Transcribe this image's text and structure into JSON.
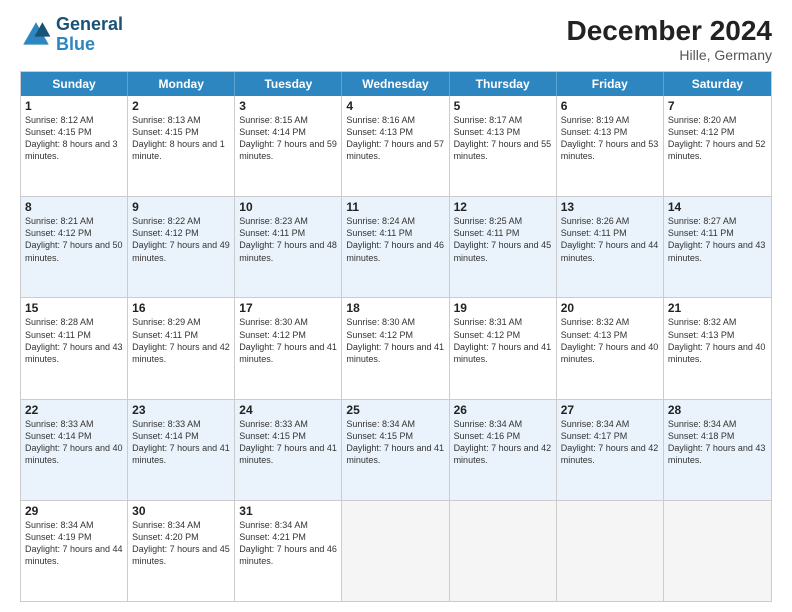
{
  "logo": {
    "general": "General",
    "blue": "Blue"
  },
  "title": "December 2024",
  "subtitle": "Hille, Germany",
  "days": [
    "Sunday",
    "Monday",
    "Tuesday",
    "Wednesday",
    "Thursday",
    "Friday",
    "Saturday"
  ],
  "weeks": [
    [
      {
        "day": "1",
        "sunrise": "8:12 AM",
        "sunset": "4:15 PM",
        "daylight": "8 hours and 3 minutes."
      },
      {
        "day": "2",
        "sunrise": "8:13 AM",
        "sunset": "4:15 PM",
        "daylight": "8 hours and 1 minute."
      },
      {
        "day": "3",
        "sunrise": "8:15 AM",
        "sunset": "4:14 PM",
        "daylight": "7 hours and 59 minutes."
      },
      {
        "day": "4",
        "sunrise": "8:16 AM",
        "sunset": "4:13 PM",
        "daylight": "7 hours and 57 minutes."
      },
      {
        "day": "5",
        "sunrise": "8:17 AM",
        "sunset": "4:13 PM",
        "daylight": "7 hours and 55 minutes."
      },
      {
        "day": "6",
        "sunrise": "8:19 AM",
        "sunset": "4:13 PM",
        "daylight": "7 hours and 53 minutes."
      },
      {
        "day": "7",
        "sunrise": "8:20 AM",
        "sunset": "4:12 PM",
        "daylight": "7 hours and 52 minutes."
      }
    ],
    [
      {
        "day": "8",
        "sunrise": "8:21 AM",
        "sunset": "4:12 PM",
        "daylight": "7 hours and 50 minutes."
      },
      {
        "day": "9",
        "sunrise": "8:22 AM",
        "sunset": "4:12 PM",
        "daylight": "7 hours and 49 minutes."
      },
      {
        "day": "10",
        "sunrise": "8:23 AM",
        "sunset": "4:11 PM",
        "daylight": "7 hours and 48 minutes."
      },
      {
        "day": "11",
        "sunrise": "8:24 AM",
        "sunset": "4:11 PM",
        "daylight": "7 hours and 46 minutes."
      },
      {
        "day": "12",
        "sunrise": "8:25 AM",
        "sunset": "4:11 PM",
        "daylight": "7 hours and 45 minutes."
      },
      {
        "day": "13",
        "sunrise": "8:26 AM",
        "sunset": "4:11 PM",
        "daylight": "7 hours and 44 minutes."
      },
      {
        "day": "14",
        "sunrise": "8:27 AM",
        "sunset": "4:11 PM",
        "daylight": "7 hours and 43 minutes."
      }
    ],
    [
      {
        "day": "15",
        "sunrise": "8:28 AM",
        "sunset": "4:11 PM",
        "daylight": "7 hours and 43 minutes."
      },
      {
        "day": "16",
        "sunrise": "8:29 AM",
        "sunset": "4:11 PM",
        "daylight": "7 hours and 42 minutes."
      },
      {
        "day": "17",
        "sunrise": "8:30 AM",
        "sunset": "4:12 PM",
        "daylight": "7 hours and 41 minutes."
      },
      {
        "day": "18",
        "sunrise": "8:30 AM",
        "sunset": "4:12 PM",
        "daylight": "7 hours and 41 minutes."
      },
      {
        "day": "19",
        "sunrise": "8:31 AM",
        "sunset": "4:12 PM",
        "daylight": "7 hours and 41 minutes."
      },
      {
        "day": "20",
        "sunrise": "8:32 AM",
        "sunset": "4:13 PM",
        "daylight": "7 hours and 40 minutes."
      },
      {
        "day": "21",
        "sunrise": "8:32 AM",
        "sunset": "4:13 PM",
        "daylight": "7 hours and 40 minutes."
      }
    ],
    [
      {
        "day": "22",
        "sunrise": "8:33 AM",
        "sunset": "4:14 PM",
        "daylight": "7 hours and 40 minutes."
      },
      {
        "day": "23",
        "sunrise": "8:33 AM",
        "sunset": "4:14 PM",
        "daylight": "7 hours and 41 minutes."
      },
      {
        "day": "24",
        "sunrise": "8:33 AM",
        "sunset": "4:15 PM",
        "daylight": "7 hours and 41 minutes."
      },
      {
        "day": "25",
        "sunrise": "8:34 AM",
        "sunset": "4:15 PM",
        "daylight": "7 hours and 41 minutes."
      },
      {
        "day": "26",
        "sunrise": "8:34 AM",
        "sunset": "4:16 PM",
        "daylight": "7 hours and 42 minutes."
      },
      {
        "day": "27",
        "sunrise": "8:34 AM",
        "sunset": "4:17 PM",
        "daylight": "7 hours and 42 minutes."
      },
      {
        "day": "28",
        "sunrise": "8:34 AM",
        "sunset": "4:18 PM",
        "daylight": "7 hours and 43 minutes."
      }
    ],
    [
      {
        "day": "29",
        "sunrise": "8:34 AM",
        "sunset": "4:19 PM",
        "daylight": "7 hours and 44 minutes."
      },
      {
        "day": "30",
        "sunrise": "8:34 AM",
        "sunset": "4:20 PM",
        "daylight": "7 hours and 45 minutes."
      },
      {
        "day": "31",
        "sunrise": "8:34 AM",
        "sunset": "4:21 PM",
        "daylight": "7 hours and 46 minutes."
      },
      null,
      null,
      null,
      null
    ]
  ]
}
